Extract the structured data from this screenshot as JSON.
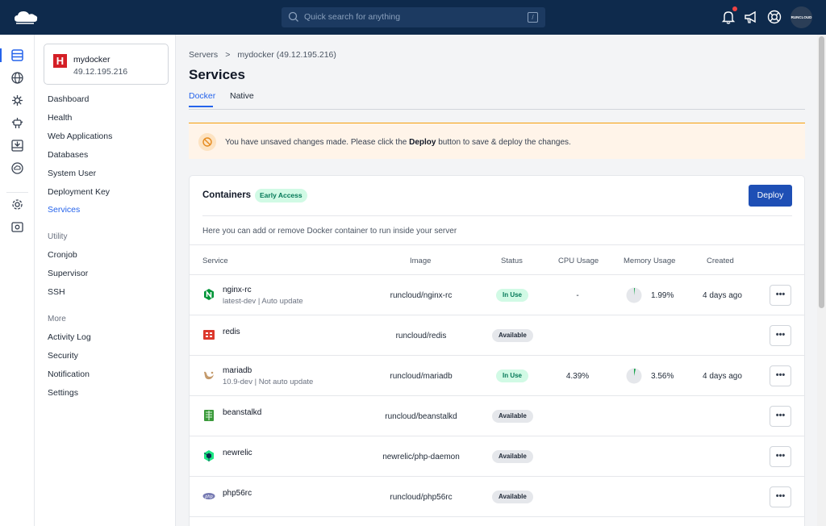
{
  "topbar": {
    "search_placeholder": "Quick search for anything",
    "search_shortcut": "/",
    "avatar_text": "RUNCLOUD",
    "icons": [
      "cloud-logo-icon",
      "search-icon",
      "bell-icon",
      "megaphone-icon",
      "lifebuoy-icon"
    ]
  },
  "rail": {
    "icons": [
      "servers-icon",
      "globe-icon",
      "plugin-icon",
      "robot-icon",
      "inbox-icon",
      "cloud-icon",
      "gear-icon",
      "vault-icon"
    ]
  },
  "sidebar": {
    "server_name": "mydocker",
    "server_ip": "49.12.195.216",
    "items": [
      "Dashboard",
      "Health",
      "Web Applications",
      "Databases",
      "System User",
      "Deployment Key",
      "Services"
    ],
    "active_item": "Services",
    "utility_heading": "Utility",
    "utility_items": [
      "Cronjob",
      "Supervisor",
      "SSH"
    ],
    "more_heading": "More",
    "more_items": [
      "Activity Log",
      "Security",
      "Notification",
      "Settings"
    ]
  },
  "breadcrumb": {
    "root": "Servers",
    "separator": ">",
    "current": "mydocker (49.12.195.216)"
  },
  "page_title": "Services",
  "tabs": [
    "Docker",
    "Native"
  ],
  "active_tab": "Docker",
  "alert": {
    "before": "You have unsaved changes made. Please click the ",
    "bold": "Deploy",
    "after": " button to save & deploy the changes."
  },
  "containers": {
    "title": "Containers",
    "badge": "Early Access",
    "deploy_label": "Deploy",
    "description": "Here you can add or remove Docker container to run inside your server",
    "columns": [
      "Service",
      "Image",
      "Status",
      "CPU Usage",
      "Memory Usage",
      "Created"
    ],
    "more_label": "•••",
    "rows": [
      {
        "name": "nginx-rc",
        "sub": "latest-dev | Auto update",
        "image": "runcloud/nginx-rc",
        "status": "In Use",
        "cpu": "-",
        "memory": "1.99%",
        "memory_fraction": 0.0199,
        "created": "4 days ago",
        "icon": "nginx-icon",
        "color": "#009639"
      },
      {
        "name": "redis",
        "sub": "",
        "image": "runcloud/redis",
        "status": "Available",
        "cpu": "",
        "memory": "",
        "created": "",
        "icon": "redis-icon",
        "color": "#dc382d"
      },
      {
        "name": "mariadb",
        "sub": "10.9-dev | Not auto update",
        "image": "runcloud/mariadb",
        "status": "In Use",
        "cpu": "4.39%",
        "memory": "3.56%",
        "memory_fraction": 0.0356,
        "created": "4 days ago",
        "icon": "mariadb-icon",
        "color": "#c49a6c"
      },
      {
        "name": "beanstalkd",
        "sub": "",
        "image": "runcloud/beanstalkd",
        "status": "Available",
        "cpu": "",
        "memory": "",
        "created": "",
        "icon": "beanstalkd-icon",
        "color": "#3a9a3a"
      },
      {
        "name": "newrelic",
        "sub": "",
        "image": "newrelic/php-daemon",
        "status": "Available",
        "cpu": "",
        "memory": "",
        "created": "",
        "icon": "newrelic-icon",
        "color": "#1ce783"
      },
      {
        "name": "php56rc",
        "sub": "",
        "image": "runcloud/php56rc",
        "status": "Available",
        "cpu": "",
        "memory": "",
        "created": "",
        "icon": "php-icon",
        "color": "#777bb3"
      }
    ]
  }
}
